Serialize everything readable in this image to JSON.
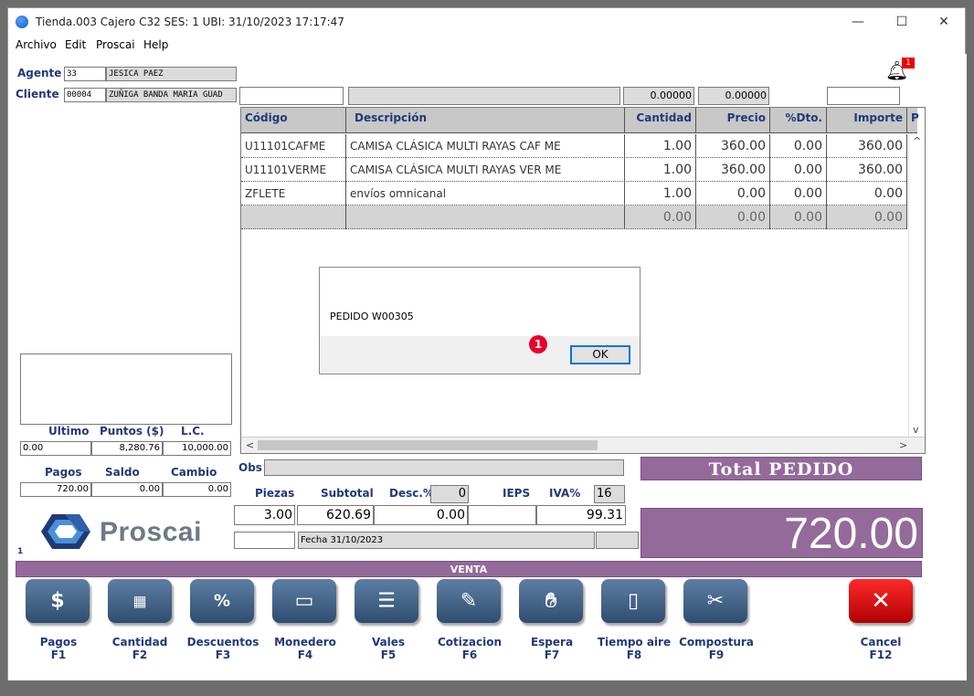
{
  "window": {
    "title": "Tienda.003  Cajero C32    SES: 1   UBI:   31/10/2023 17:17:47",
    "minimize": "—",
    "maximize": "☐",
    "close": "✕"
  },
  "menu": [
    "Archivo",
    "Edit",
    "Proscai",
    "Help"
  ],
  "header": {
    "agente_label": "Agente",
    "agente_code": "33",
    "agente_name": "JESICA PAEZ",
    "cliente_label": "Cliente",
    "cliente_code": "00004",
    "cliente_name": "ZUÑIGA BANDA MARIA GUAD",
    "field_a": "0.00000",
    "field_b": "0.00000",
    "notification_count": "1"
  },
  "grid": {
    "columns": [
      "Código",
      "Descripción",
      "Cantidad",
      "Precio",
      "%Dto.",
      "Importe",
      "P"
    ],
    "rows": [
      {
        "codigo": "U11101CAFME",
        "descripcion": "CAMISA CLÁSICA MULTI RAYAS CAF ME",
        "cantidad": "1.00",
        "precio": "360.00",
        "dto": "0.00",
        "importe": "360.00"
      },
      {
        "codigo": "U11101VERME",
        "descripcion": "CAMISA CLÁSICA MULTI RAYAS VER ME",
        "cantidad": "1.00",
        "precio": "360.00",
        "dto": "0.00",
        "importe": "360.00"
      },
      {
        "codigo": "ZFLETE",
        "descripcion": "envíos omnicanal",
        "cantidad": "1.00",
        "precio": "0.00",
        "dto": "0.00",
        "importe": "0.00"
      },
      {
        "codigo": "",
        "descripcion": "",
        "cantidad": "0.00",
        "precio": "0.00",
        "dto": "0.00",
        "importe": "0.00"
      }
    ]
  },
  "dialog": {
    "message": "PEDIDO W00305",
    "ok": "OK",
    "marker": "1"
  },
  "left_panel": {
    "ultimo_label": "Ultimo",
    "puntos_label": "Puntos ($)",
    "lc_label": "L.C.",
    "ultimo": "0.00",
    "puntos": "8,280.76",
    "lc": "10,000.00",
    "pagos_label": "Pagos",
    "saldo_label": "Saldo",
    "cambio_label": "Cambio",
    "pagos": "720.00",
    "saldo": "0.00",
    "cambio": "0.00",
    "logo_text": "Proscai",
    "counter": "1"
  },
  "summary": {
    "obs_label": "Obs",
    "piezas_label": "Piezas",
    "subtotal_label": "Subtotal",
    "desc_label": "Desc.%",
    "desc_value": "0",
    "ieps_label": "IEPS",
    "iva_label": "IVA%",
    "iva_rate": "16",
    "piezas": "3.00",
    "subtotal": "620.69",
    "desc_amount": "0.00",
    "iva_amount": "99.31",
    "fecha": "Fecha 31/10/2023"
  },
  "total": {
    "label": "Total PEDIDO",
    "value": "720.00"
  },
  "venta_label": "VENTA",
  "buttons": [
    {
      "name": "Pagos",
      "key": "F1"
    },
    {
      "name": "Cantidad",
      "key": "F2"
    },
    {
      "name": "Descuentos",
      "key": "F3"
    },
    {
      "name": "Monedero",
      "key": "F4"
    },
    {
      "name": "Vales",
      "key": "F5"
    },
    {
      "name": "Cotizacion",
      "key": "F6"
    },
    {
      "name": "Espera",
      "key": "F7"
    },
    {
      "name": "Tiempo aire",
      "key": "F8"
    },
    {
      "name": "Compostura",
      "key": "F9"
    },
    {
      "name": "Cancel",
      "key": "F12"
    }
  ]
}
